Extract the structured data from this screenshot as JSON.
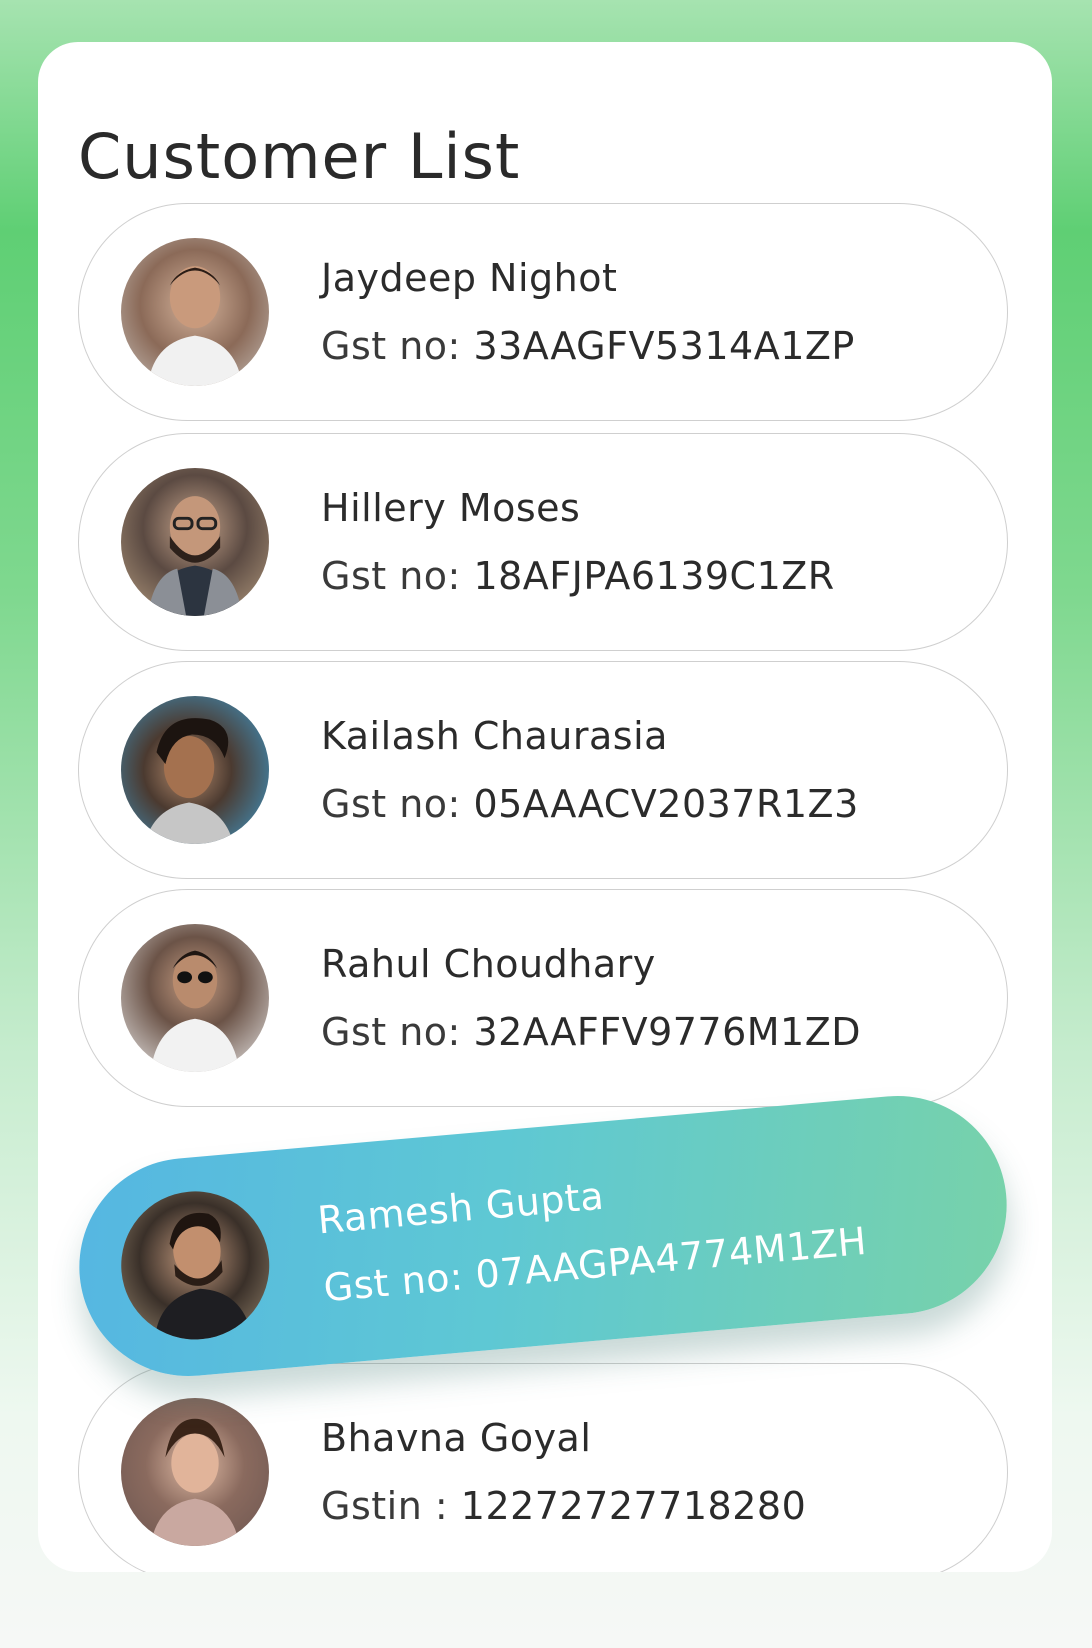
{
  "page": {
    "title": "Customer List"
  },
  "customers": [
    {
      "name": "Jaydeep Nighot",
      "id_label": "Gst no:",
      "id_value": "33AAGFV5314A1ZP",
      "avatar": "avatar-photo",
      "selected": false
    },
    {
      "name": "Hillery Moses",
      "id_label": "Gst no:",
      "id_value": "18AFJPA6139C1ZR",
      "avatar": "avatar-photo",
      "selected": false
    },
    {
      "name": "Kailash Chaurasia",
      "id_label": "Gst no:",
      "id_value": "05AAACV2037R1Z3",
      "avatar": "avatar-photo",
      "selected": false
    },
    {
      "name": "Rahul Choudhary",
      "id_label": "Gst no:",
      "id_value": "32AAFFV9776M1ZD",
      "avatar": "avatar-photo",
      "selected": false
    },
    {
      "name": "Ramesh Gupta",
      "id_label": "Gst no:",
      "id_value": "07AAGPA4774M1ZH",
      "avatar": "avatar-photo",
      "selected": true
    },
    {
      "name": "Bhavna Goyal",
      "id_label": "Gstin :",
      "id_value": "12272727718280",
      "avatar": "avatar-photo",
      "selected": false
    }
  ],
  "colors": {
    "selected_gradient_start": "#55b6e2",
    "selected_gradient_end": "#78d2a9",
    "background_green": "#5fcf74",
    "text_dark": "#2b2b2b"
  }
}
